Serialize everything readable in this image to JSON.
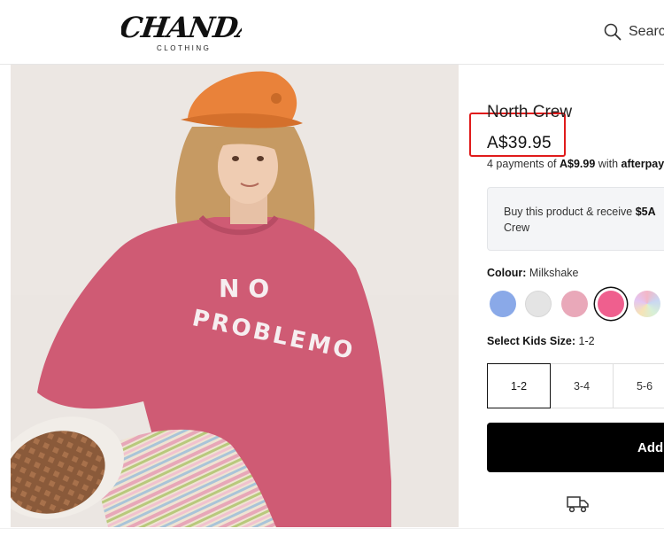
{
  "header": {
    "logo_text": "CHANDA",
    "logo_subtext": "CLOTHING",
    "search_label": "Search"
  },
  "product": {
    "title": "North Crew",
    "price": "A$39.95",
    "image_print_text": "NO PROBLEMO",
    "afterpay": {
      "prefix": "4 payments of",
      "amount": "A$9.99",
      "mid": "with",
      "brand": "afterpay"
    },
    "promo": {
      "line1": "Buy this product & receive",
      "amount": "$5A",
      "line2": "Crew"
    },
    "colour": {
      "label": "Colour:",
      "selected": "Milkshake",
      "swatches": [
        {
          "name": "Blue",
          "color": "#8aa9e8"
        },
        {
          "name": "Grey",
          "color": "#e4e4e4"
        },
        {
          "name": "Light Pink",
          "color": "#e9a8b9"
        },
        {
          "name": "Milkshake",
          "color": "#ef5f8e"
        },
        {
          "name": "Multi",
          "color": "#d8d2f2"
        }
      ]
    },
    "size": {
      "label": "Select Kids Size:",
      "selected": "1-2",
      "options": [
        "1-2",
        "3-4",
        "5-6"
      ]
    },
    "add_button": "Add"
  },
  "colors": {
    "highlight_red": "#e01b1b",
    "sweater_pink": "#cf5b74",
    "cap_orange": "#e9823a"
  }
}
